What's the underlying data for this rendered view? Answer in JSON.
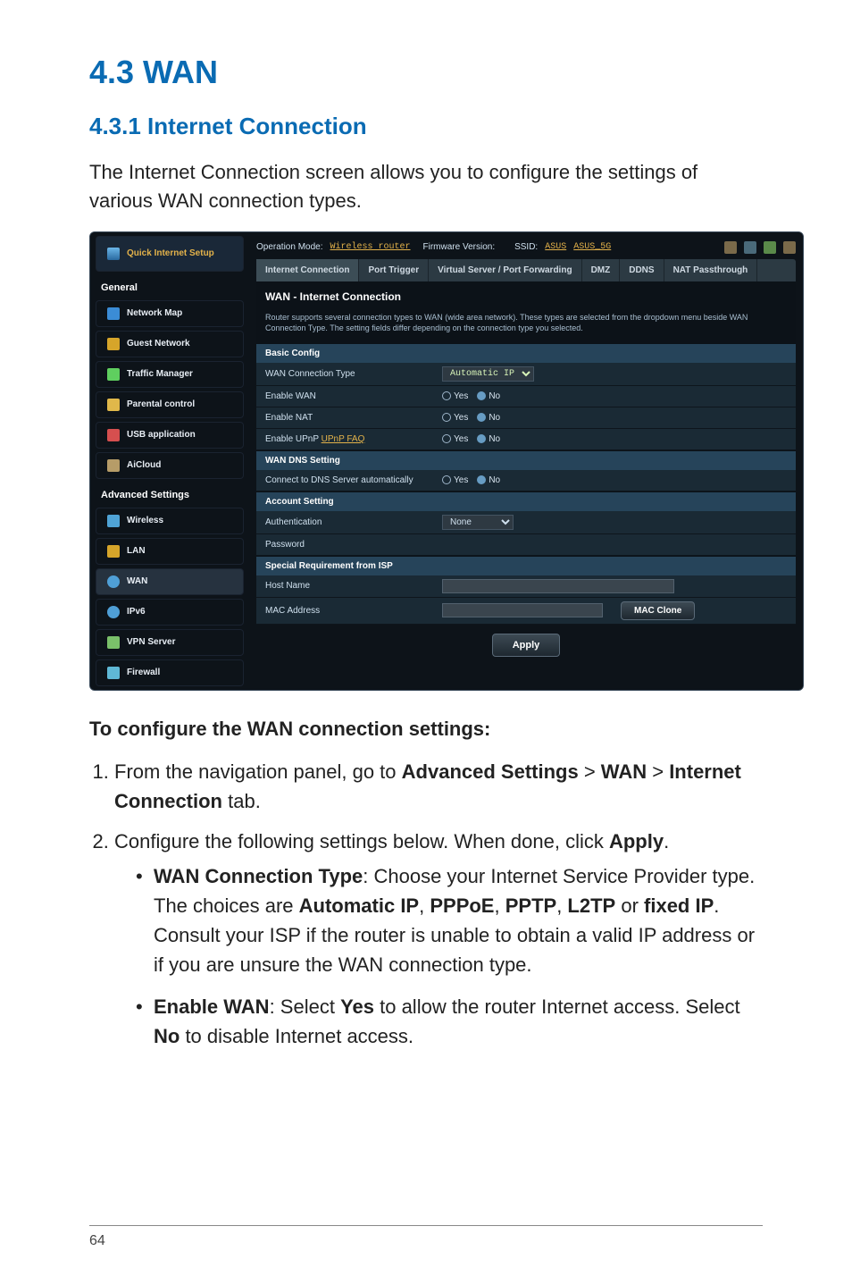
{
  "section_title": "4.3    WAN",
  "subsection_title": "4.3.1 Internet Connection",
  "intro_text": "The Internet Connection screen allows you to configure the settings of various WAN connection types.",
  "router": {
    "topbar": {
      "op_mode_label": "Operation Mode:",
      "op_mode_value": "Wireless router",
      "fw_label": "Firmware Version:",
      "ssid_label": "SSID:",
      "ssid1": "ASUS",
      "ssid2": "ASUS_5G"
    },
    "tabs": {
      "internet_connection": "Internet Connection",
      "port_trigger": "Port Trigger",
      "virtual_server": "Virtual Server / Port Forwarding",
      "dmz": "DMZ",
      "ddns": "DDNS",
      "nat_passthrough": "NAT Passthrough"
    },
    "panel": {
      "title": "WAN - Internet Connection",
      "desc": "Router supports several connection types to WAN (wide area network). These types are selected from the dropdown menu beside WAN Connection Type. The setting fields differ depending on the connection type you selected."
    },
    "sections": {
      "basic": "Basic Config",
      "wan_dns": "WAN DNS Setting",
      "account": "Account Setting",
      "special": "Special Requirement from ISP"
    },
    "rows": {
      "wan_conn_type": "WAN Connection Type",
      "wan_conn_type_val": "Automatic IP",
      "enable_wan": "Enable WAN",
      "enable_nat": "Enable NAT",
      "enable_upnp": "Enable UPnP   ",
      "upnp_faq": "UPnP  FAQ",
      "connect_dns": "Connect to DNS Server automatically",
      "authentication": "Authentication",
      "auth_val": "None",
      "password": "Password",
      "host_name": "Host Name",
      "mac_address": "MAC Address",
      "yes": "Yes",
      "no": "No",
      "mac_clone": "MAC Clone",
      "apply": "Apply"
    },
    "sidebar": {
      "quick_internet": "Quick Internet Setup",
      "general": "General",
      "network_map": "Network Map",
      "guest_network": "Guest Network",
      "traffic_manager": "Traffic Manager",
      "parental_control": "Parental control",
      "usb_application": "USB application",
      "aicloud": "AiCloud",
      "advanced": "Advanced Settings",
      "wireless": "Wireless",
      "lan": "LAN",
      "wan": "WAN",
      "ipv6": "IPv6",
      "vpn_server": "VPN Server",
      "firewall": "Firewall"
    }
  },
  "instructions": {
    "heading": "To configure the WAN connection settings:",
    "step1_a": "From the navigation panel, go to ",
    "step1_b": "Advanced Settings",
    "step1_c": " > ",
    "step1_d": "WAN",
    "step1_e": " > ",
    "step1_f": "Internet Connection",
    "step1_g": " tab.",
    "step2_a": "Configure the following settings below. When done, click ",
    "step2_b": "Apply",
    "step2_c": ".",
    "bullet1_a": "WAN Connection Type",
    "bullet1_b": ": Choose your Internet Service Provider type. The choices are ",
    "bullet1_c": "Automatic IP",
    "bullet1_d": ", ",
    "bullet1_e": "PPPoE",
    "bullet1_f": ", ",
    "bullet1_g": "PPTP",
    "bullet1_h": ", ",
    "bullet1_i": "L2TP",
    "bullet1_j": " or ",
    "bullet1_k": "fixed IP",
    "bullet1_l": ". Consult your ISP if the router is unable to obtain a valid IP address or if you are unsure the WAN connection type.",
    "bullet2_a": "Enable WAN",
    "bullet2_b": ": Select ",
    "bullet2_c": "Yes",
    "bullet2_d": " to allow the router Internet access. Select ",
    "bullet2_e": "No",
    "bullet2_f": " to disable Internet access."
  },
  "page_number": "64"
}
